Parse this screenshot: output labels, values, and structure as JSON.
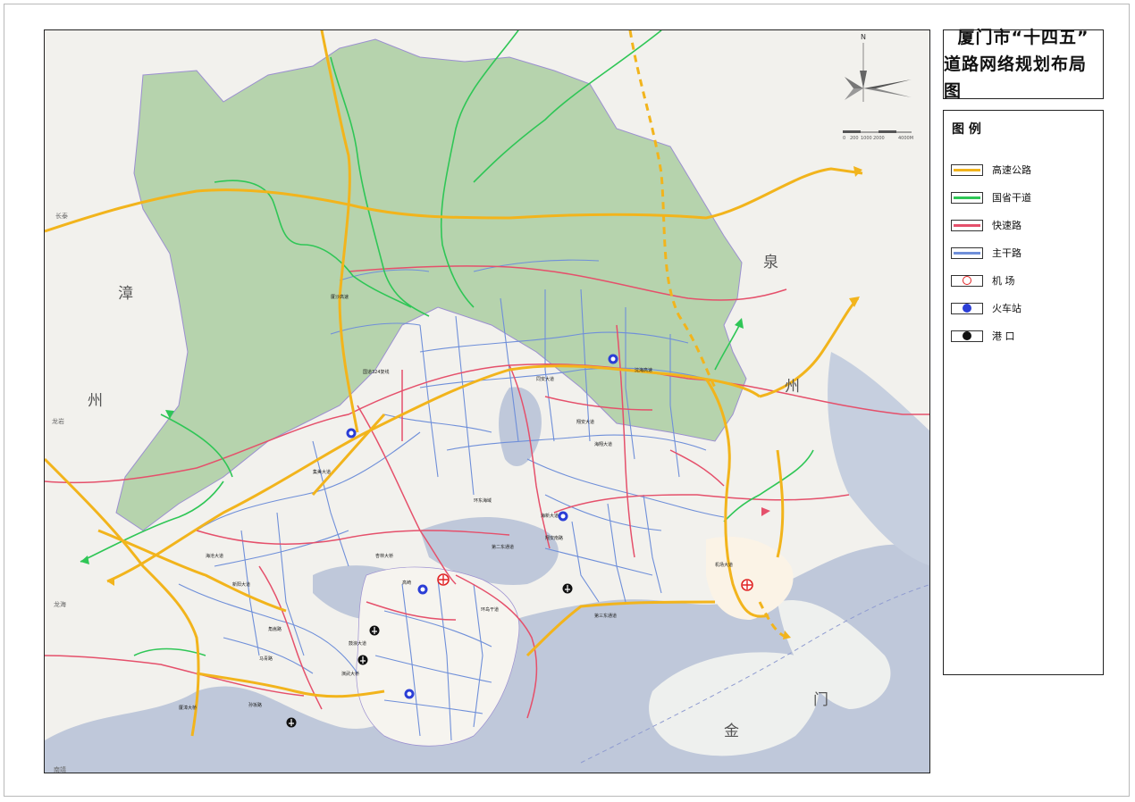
{
  "title": {
    "line1": "厦门市“十四五”",
    "line2": "道路网络规划布局图"
  },
  "legend": {
    "heading": "图 例",
    "items": [
      {
        "label": "高速公路",
        "kind": "line",
        "color": "#f2b41c",
        "icon": "highway-line-icon"
      },
      {
        "label": "国省干道",
        "kind": "line",
        "color": "#2fc656",
        "icon": "national-road-line-icon"
      },
      {
        "label": "快速路",
        "kind": "line",
        "color": "#e5506b",
        "icon": "expressway-line-icon"
      },
      {
        "label": "主干路",
        "kind": "line",
        "color": "#6f8fd9",
        "icon": "arterial-road-line-icon"
      },
      {
        "label": "机    场",
        "kind": "symbol",
        "color": "#e02424",
        "icon": "airport-icon"
      },
      {
        "label": "火车站",
        "kind": "symbol",
        "color": "#2b3ed6",
        "icon": "train-station-icon"
      },
      {
        "label": "港    口",
        "kind": "symbol",
        "color": "#111111",
        "icon": "port-icon"
      }
    ]
  },
  "compass": {
    "north": "N",
    "scale_labels": [
      "0",
      "200",
      "1000",
      "2000",
      "4000M"
    ]
  },
  "map_labels": {
    "zhang": "漳",
    "zhou_left": "州",
    "quan": "泉",
    "zhou_right": "州",
    "men": "门",
    "jin": "金",
    "changtai": "长泰",
    "longyan": "龙岩",
    "longhai": "龙海",
    "nanjing": "南靖"
  },
  "road_names": [
    "沈海高速",
    "厦沙高速",
    "国道324复线",
    "翔安大道",
    "同安大道",
    "海翔大道",
    "第二东通道",
    "第三东通道",
    "环岛干道",
    "厦漳大桥",
    "鼓浪大道",
    "马青路",
    "海沧大道",
    "角嵩路",
    "孙坂路",
    "环东海域",
    "翔安南路",
    "机场大道",
    "高崎",
    "新阳大道",
    "集美大道",
    "杏林大桥",
    "海新大道",
    "演武大桥"
  ],
  "colors": {
    "highway": "#f2b41c",
    "national": "#2fc656",
    "express": "#e5506b",
    "arterial": "#6f8fd9",
    "mountain": "#b6d3ad",
    "sea": "#bcc6d8",
    "land": "#f3f2ee"
  }
}
